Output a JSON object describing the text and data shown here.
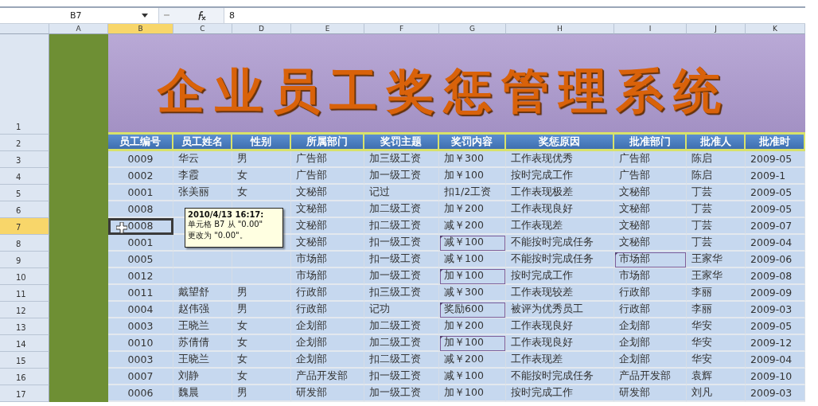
{
  "formula_bar": {
    "name_box": "B7",
    "value": "8"
  },
  "columns": [
    {
      "label": "A",
      "selected": false
    },
    {
      "label": "B",
      "selected": true
    },
    {
      "label": "C",
      "selected": false
    },
    {
      "label": "D",
      "selected": false
    },
    {
      "label": "E",
      "selected": false
    },
    {
      "label": "F",
      "selected": false
    },
    {
      "label": "G",
      "selected": false
    },
    {
      "label": "H",
      "selected": false
    },
    {
      "label": "I",
      "selected": false
    },
    {
      "label": "J",
      "selected": false
    },
    {
      "label": "K",
      "selected": false
    }
  ],
  "title_row": {
    "number": "1",
    "title": "企业员工奖惩管理系统"
  },
  "header_row": {
    "number": "2",
    "headers": [
      "员工编号",
      "员工姓名",
      "性别",
      "所属部门",
      "奖罚主题",
      "奖罚内容",
      "奖惩原因",
      "批准部门",
      "批准人",
      "批准时"
    ]
  },
  "rows": [
    {
      "number": "3",
      "selected": false,
      "commented_cells": [
        false,
        false,
        false,
        false,
        false,
        false,
        false,
        false,
        false,
        false
      ],
      "cells": [
        "0009",
        "华云",
        "男",
        "广告部",
        "加三级工资",
        "加￥300",
        "工作表现优秀",
        "广告部",
        "陈启",
        "2009-05"
      ]
    },
    {
      "number": "4",
      "selected": false,
      "commented_cells": [
        false,
        false,
        false,
        false,
        false,
        false,
        false,
        false,
        false,
        false
      ],
      "cells": [
        "0002",
        "李霞",
        "女",
        "广告部",
        "加一级工资",
        "加￥100",
        "按时完成工作",
        "广告部",
        "陈启",
        "2009-1"
      ]
    },
    {
      "number": "5",
      "selected": false,
      "commented_cells": [
        false,
        false,
        false,
        false,
        false,
        false,
        false,
        false,
        false,
        false
      ],
      "cells": [
        "0001",
        "张美丽",
        "女",
        "文秘部",
        "记过",
        "扣1/2工资",
        "工作表现极差",
        "文秘部",
        "丁芸",
        "2009-05"
      ]
    },
    {
      "number": "6",
      "selected": false,
      "commented_cells": [
        false,
        null,
        null,
        false,
        false,
        false,
        false,
        false,
        false,
        false
      ],
      "cells": [
        "0008",
        null,
        null,
        "文秘部",
        "加二级工资",
        "加￥200",
        "工作表现良好",
        "文秘部",
        "丁芸",
        "2009-05"
      ]
    },
    {
      "number": "7",
      "selected": true,
      "commented_cells": [
        false,
        null,
        null,
        false,
        false,
        false,
        false,
        false,
        false,
        false
      ],
      "cells": [
        "0008",
        null,
        null,
        "文秘部",
        "扣二级工资",
        "减￥200",
        "工作表现差",
        "文秘部",
        "丁芸",
        "2009-07"
      ]
    },
    {
      "number": "8",
      "selected": false,
      "commented_cells": [
        false,
        null,
        null,
        false,
        false,
        true,
        false,
        false,
        false,
        false
      ],
      "cells": [
        "0001",
        null,
        null,
        "文秘部",
        "扣一级工资",
        "减￥100",
        "不能按时完成任务",
        "文秘部",
        "丁芸",
        "2009-04"
      ]
    },
    {
      "number": "9",
      "selected": false,
      "commented_cells": [
        false,
        null,
        null,
        false,
        false,
        false,
        false,
        true,
        false,
        false
      ],
      "cells": [
        "0005",
        null,
        null,
        "市场部",
        "扣一级工资",
        "减￥100",
        "不能按时完成任务",
        "市场部",
        "王家华",
        "2009-06"
      ]
    },
    {
      "number": "10",
      "selected": false,
      "commented_cells": [
        false,
        null,
        null,
        false,
        false,
        true,
        false,
        false,
        false,
        false
      ],
      "cells": [
        "0012",
        null,
        null,
        "市场部",
        "加一级工资",
        "加￥100",
        "按时完成工作",
        "市场部",
        "王家华",
        "2009-08"
      ]
    },
    {
      "number": "11",
      "selected": false,
      "commented_cells": [
        false,
        false,
        false,
        false,
        false,
        false,
        false,
        false,
        false,
        false
      ],
      "cells": [
        "0011",
        "戴望舒",
        "男",
        "行政部",
        "扣三级工资",
        "减￥300",
        "工作表现较差",
        "行政部",
        "李丽",
        "2009-09"
      ]
    },
    {
      "number": "12",
      "selected": false,
      "commented_cells": [
        false,
        false,
        false,
        false,
        false,
        true,
        false,
        false,
        false,
        false
      ],
      "cells": [
        "0004",
        "赵伟强",
        "男",
        "行政部",
        "记功",
        "奖励600",
        "被评为优秀员工",
        "行政部",
        "李丽",
        "2009-03"
      ]
    },
    {
      "number": "13",
      "selected": false,
      "commented_cells": [
        false,
        false,
        false,
        false,
        false,
        false,
        false,
        false,
        false,
        false
      ],
      "cells": [
        "0003",
        "王晓兰",
        "女",
        "企划部",
        "加二级工资",
        "加￥200",
        "工作表现良好",
        "企划部",
        "华安",
        "2009-05"
      ]
    },
    {
      "number": "14",
      "selected": false,
      "commented_cells": [
        false,
        false,
        false,
        false,
        false,
        true,
        false,
        false,
        false,
        false
      ],
      "cells": [
        "0010",
        "苏倩倩",
        "女",
        "企划部",
        "加二级工资",
        "加￥100",
        "工作表现良好",
        "企划部",
        "华安",
        "2009-12"
      ]
    },
    {
      "number": "15",
      "selected": false,
      "commented_cells": [
        false,
        false,
        false,
        false,
        false,
        false,
        false,
        false,
        false,
        false
      ],
      "cells": [
        "0003",
        "王晓兰",
        "女",
        "企划部",
        "扣二级工资",
        "减￥200",
        "工作表现差",
        "企划部",
        "华安",
        "2009-04"
      ]
    },
    {
      "number": "16",
      "selected": false,
      "commented_cells": [
        false,
        false,
        false,
        false,
        false,
        false,
        false,
        false,
        false,
        false
      ],
      "cells": [
        "0007",
        "刘静",
        "女",
        "产品开发部",
        "扣一级工资",
        "减￥100",
        "不能按时完成任务",
        "产品开发部",
        "袁辉",
        "2009-10"
      ]
    },
    {
      "number": "17",
      "selected": false,
      "commented_cells": [
        false,
        false,
        false,
        false,
        false,
        false,
        false,
        false,
        false,
        false
      ],
      "cells": [
        "0006",
        "魏晨",
        "男",
        "研发部",
        "加一级工资",
        "加￥100",
        "按时完成工作",
        "研发部",
        "刘凡",
        "2009-03"
      ]
    }
  ],
  "comment": {
    "time": "2010/4/13 16:17:",
    "lines": [
      "单元格 B7 从 \"0.00\"",
      "更改为 \"0.00\"。"
    ]
  }
}
